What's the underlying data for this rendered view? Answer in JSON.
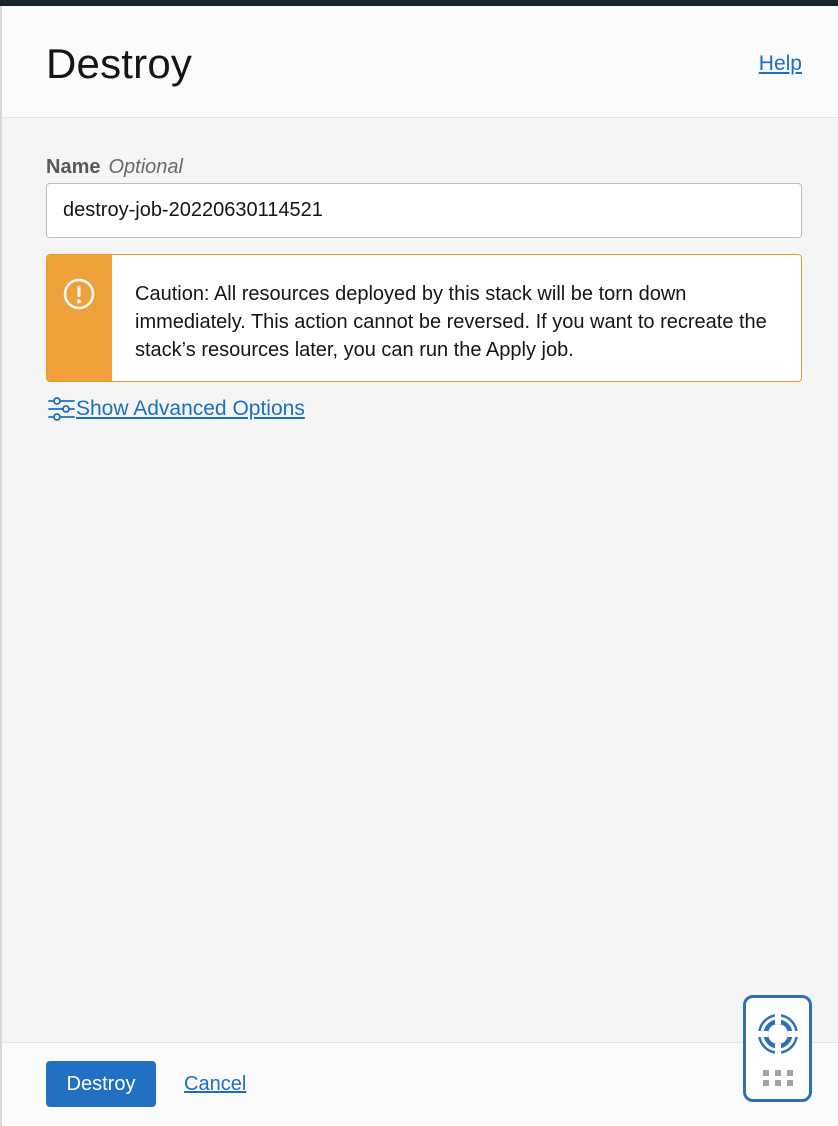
{
  "header": {
    "title": "Destroy",
    "help_label": "Help"
  },
  "form": {
    "name_label": "Name",
    "name_optional": "Optional",
    "name_value": "destroy-job-20220630114521"
  },
  "caution": {
    "icon": "warning-icon",
    "text": "Caution: All resources deployed by this stack will be torn down immediately. This action cannot be reversed. If you want to recreate the stack’s resources later, you can run the Apply job."
  },
  "advanced": {
    "icon": "sliders-icon",
    "label": "Show Advanced Options"
  },
  "footer": {
    "destroy_label": "Destroy",
    "cancel_label": "Cancel"
  },
  "help_widget": {
    "icon": "lifebuoy-icon",
    "menu_icon": "grid-dots-icon"
  },
  "colors": {
    "accent": "#2270c4",
    "link": "#1a6fc4",
    "warning": "#f0a03a"
  }
}
